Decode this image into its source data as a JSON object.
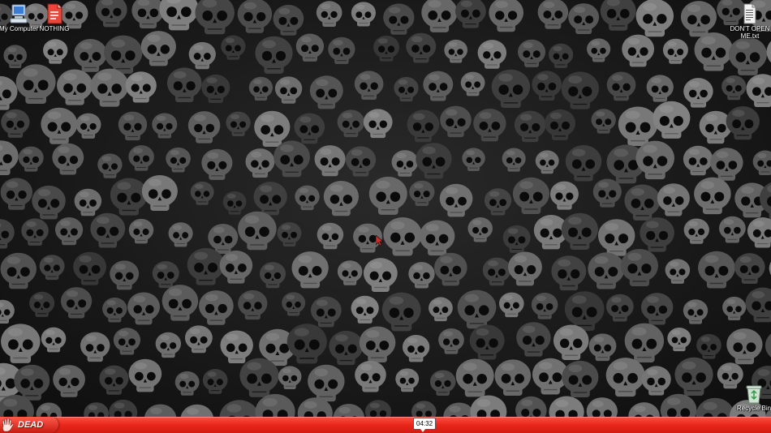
{
  "desktop": {
    "wallpaper": "skulls-wallpaper",
    "icons": [
      {
        "label": "My Computer",
        "icon": "my-computer-icon"
      },
      {
        "label": "NOTHING",
        "icon": "document-icon"
      },
      {
        "label": "DON'T OPEN ME.txt",
        "icon": "text-file-icon"
      },
      {
        "label": "Recycle Bin",
        "icon": "recycle-bin-icon"
      }
    ]
  },
  "taskbar": {
    "start_label": "DEAD",
    "clock": "04:32",
    "color": "#e8251a"
  }
}
